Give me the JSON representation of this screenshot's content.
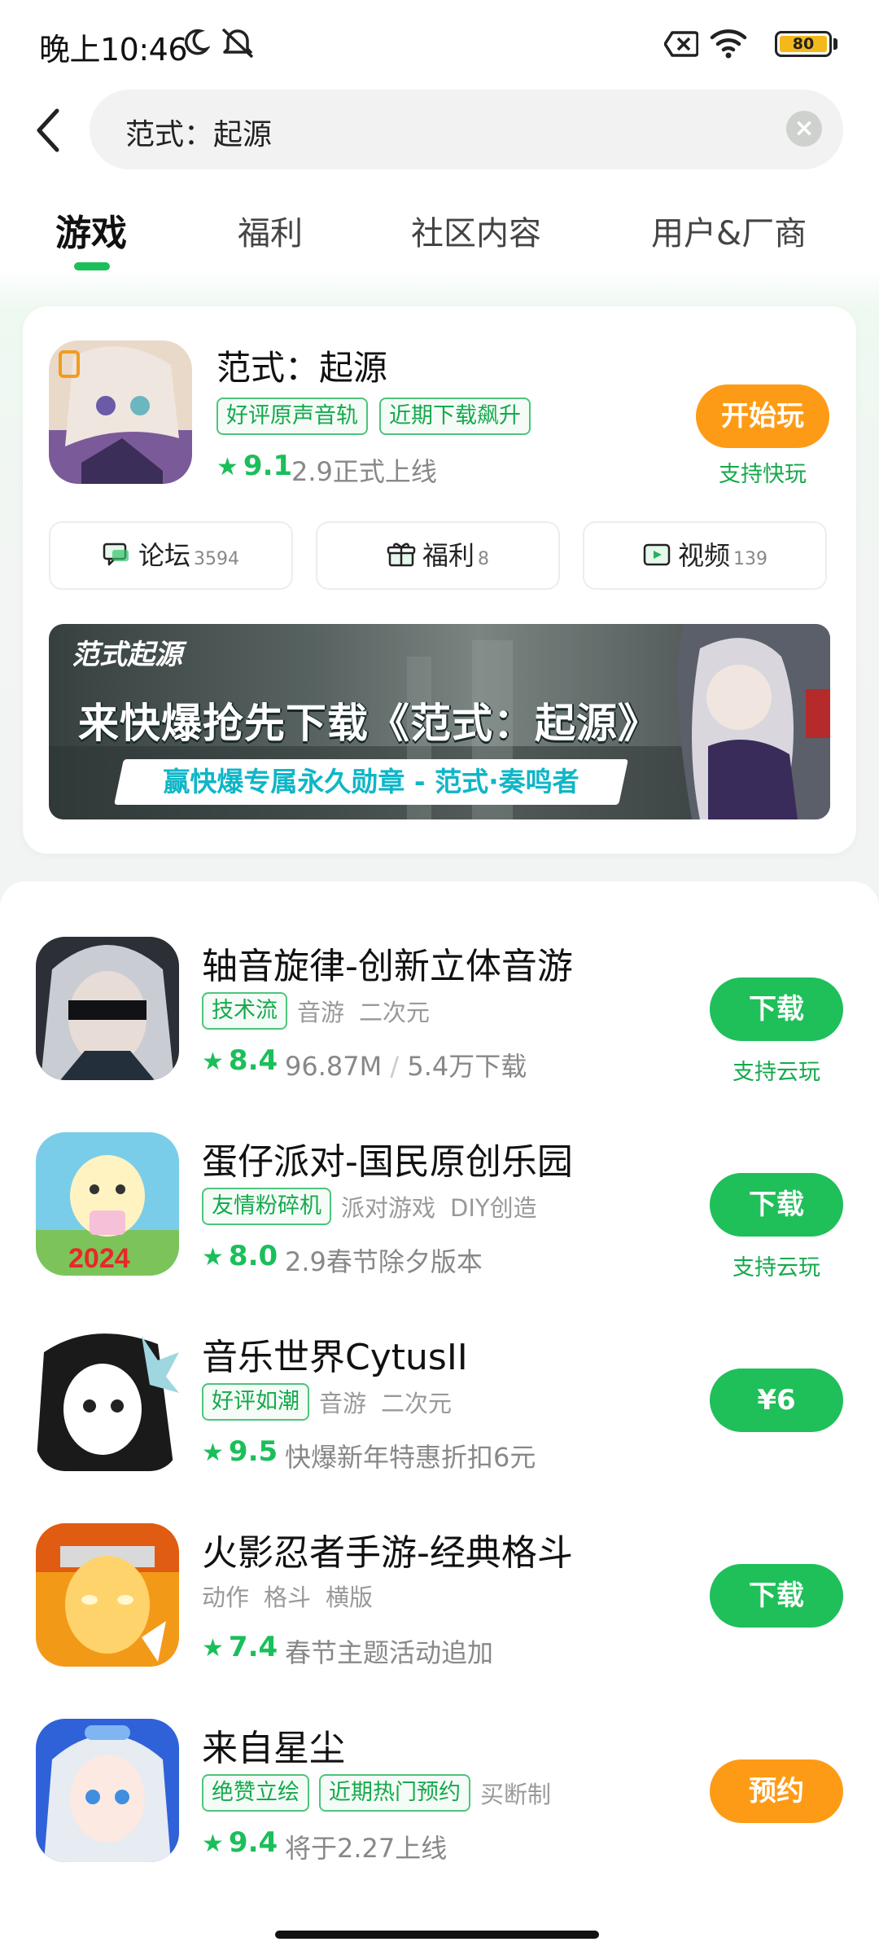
{
  "status_bar": {
    "time": "晚上10:46",
    "battery": "80",
    "icons": [
      "moon-icon",
      "silent-icon",
      "sim-off-icon",
      "wifi-icon",
      "battery-icon"
    ]
  },
  "search": {
    "query": "范式：起源",
    "back_icon": "chevron-left-icon",
    "clear_icon": "clear-icon"
  },
  "tabs": [
    {
      "label": "游戏",
      "active": true
    },
    {
      "label": "福利",
      "active": false
    },
    {
      "label": "社区内容",
      "active": false
    },
    {
      "label": "用户&厂商",
      "active": false
    }
  ],
  "featured": {
    "title": "范式：起源",
    "tags": [
      "好评原声音轨",
      "近期下载飙升"
    ],
    "rating": "9.1",
    "info": "2.9正式上线",
    "button": "开始玩",
    "button_sub": "支持快玩",
    "pills": [
      {
        "label": "论坛",
        "count": "3594",
        "icon": "forum-icon"
      },
      {
        "label": "福利",
        "count": "8",
        "icon": "gift-icon"
      },
      {
        "label": "视频",
        "count": "139",
        "icon": "video-icon"
      }
    ],
    "banner": {
      "logo": "范式起源",
      "headline": "来快爆抢先下载《范式：起源》",
      "subline": "赢快爆专属永久勋章 - 范式·奏鸣者"
    }
  },
  "results": [
    {
      "name": "轴音旋律-创新立体音游",
      "tags": [
        "技术流"
      ],
      "genres": [
        "音游",
        "二次元"
      ],
      "rating": "8.4",
      "info": "96.87M",
      "info_sep": "/",
      "info2": "5.4万下载",
      "button": "下载",
      "button_color": "#1fbf5a",
      "button_sub": "支持云玩"
    },
    {
      "name": "蛋仔派对-国民原创乐园",
      "tags": [
        "友情粉碎机"
      ],
      "genres": [
        "派对游戏",
        "DIY创造"
      ],
      "rating": "8.0",
      "info": "2.9春节除夕版本",
      "button": "下载",
      "button_color": "#1fbf5a",
      "button_sub": "支持云玩"
    },
    {
      "name": "音乐世界CytusII",
      "tags": [
        "好评如潮"
      ],
      "genres": [
        "音游",
        "二次元"
      ],
      "rating": "9.5",
      "info": "快爆新年特惠折扣6元",
      "button": "¥6",
      "button_color": "#1fbf5a"
    },
    {
      "name": "火影忍者手游-经典格斗",
      "tags": [],
      "genres": [
        "动作",
        "格斗",
        "横版"
      ],
      "rating": "7.4",
      "info": "春节主题活动追加",
      "button": "下载",
      "button_color": "#1fbf5a"
    },
    {
      "name": "来自星尘",
      "tags": [
        "绝赞立绘",
        "近期热门预约"
      ],
      "genres": [
        "买断制"
      ],
      "rating": "9.4",
      "info": "将于2.27上线",
      "button": "预约",
      "button_color": "#fe9b16"
    }
  ],
  "colors": {
    "accent_green": "#1fbf5a",
    "accent_orange": "#fe9b16"
  }
}
